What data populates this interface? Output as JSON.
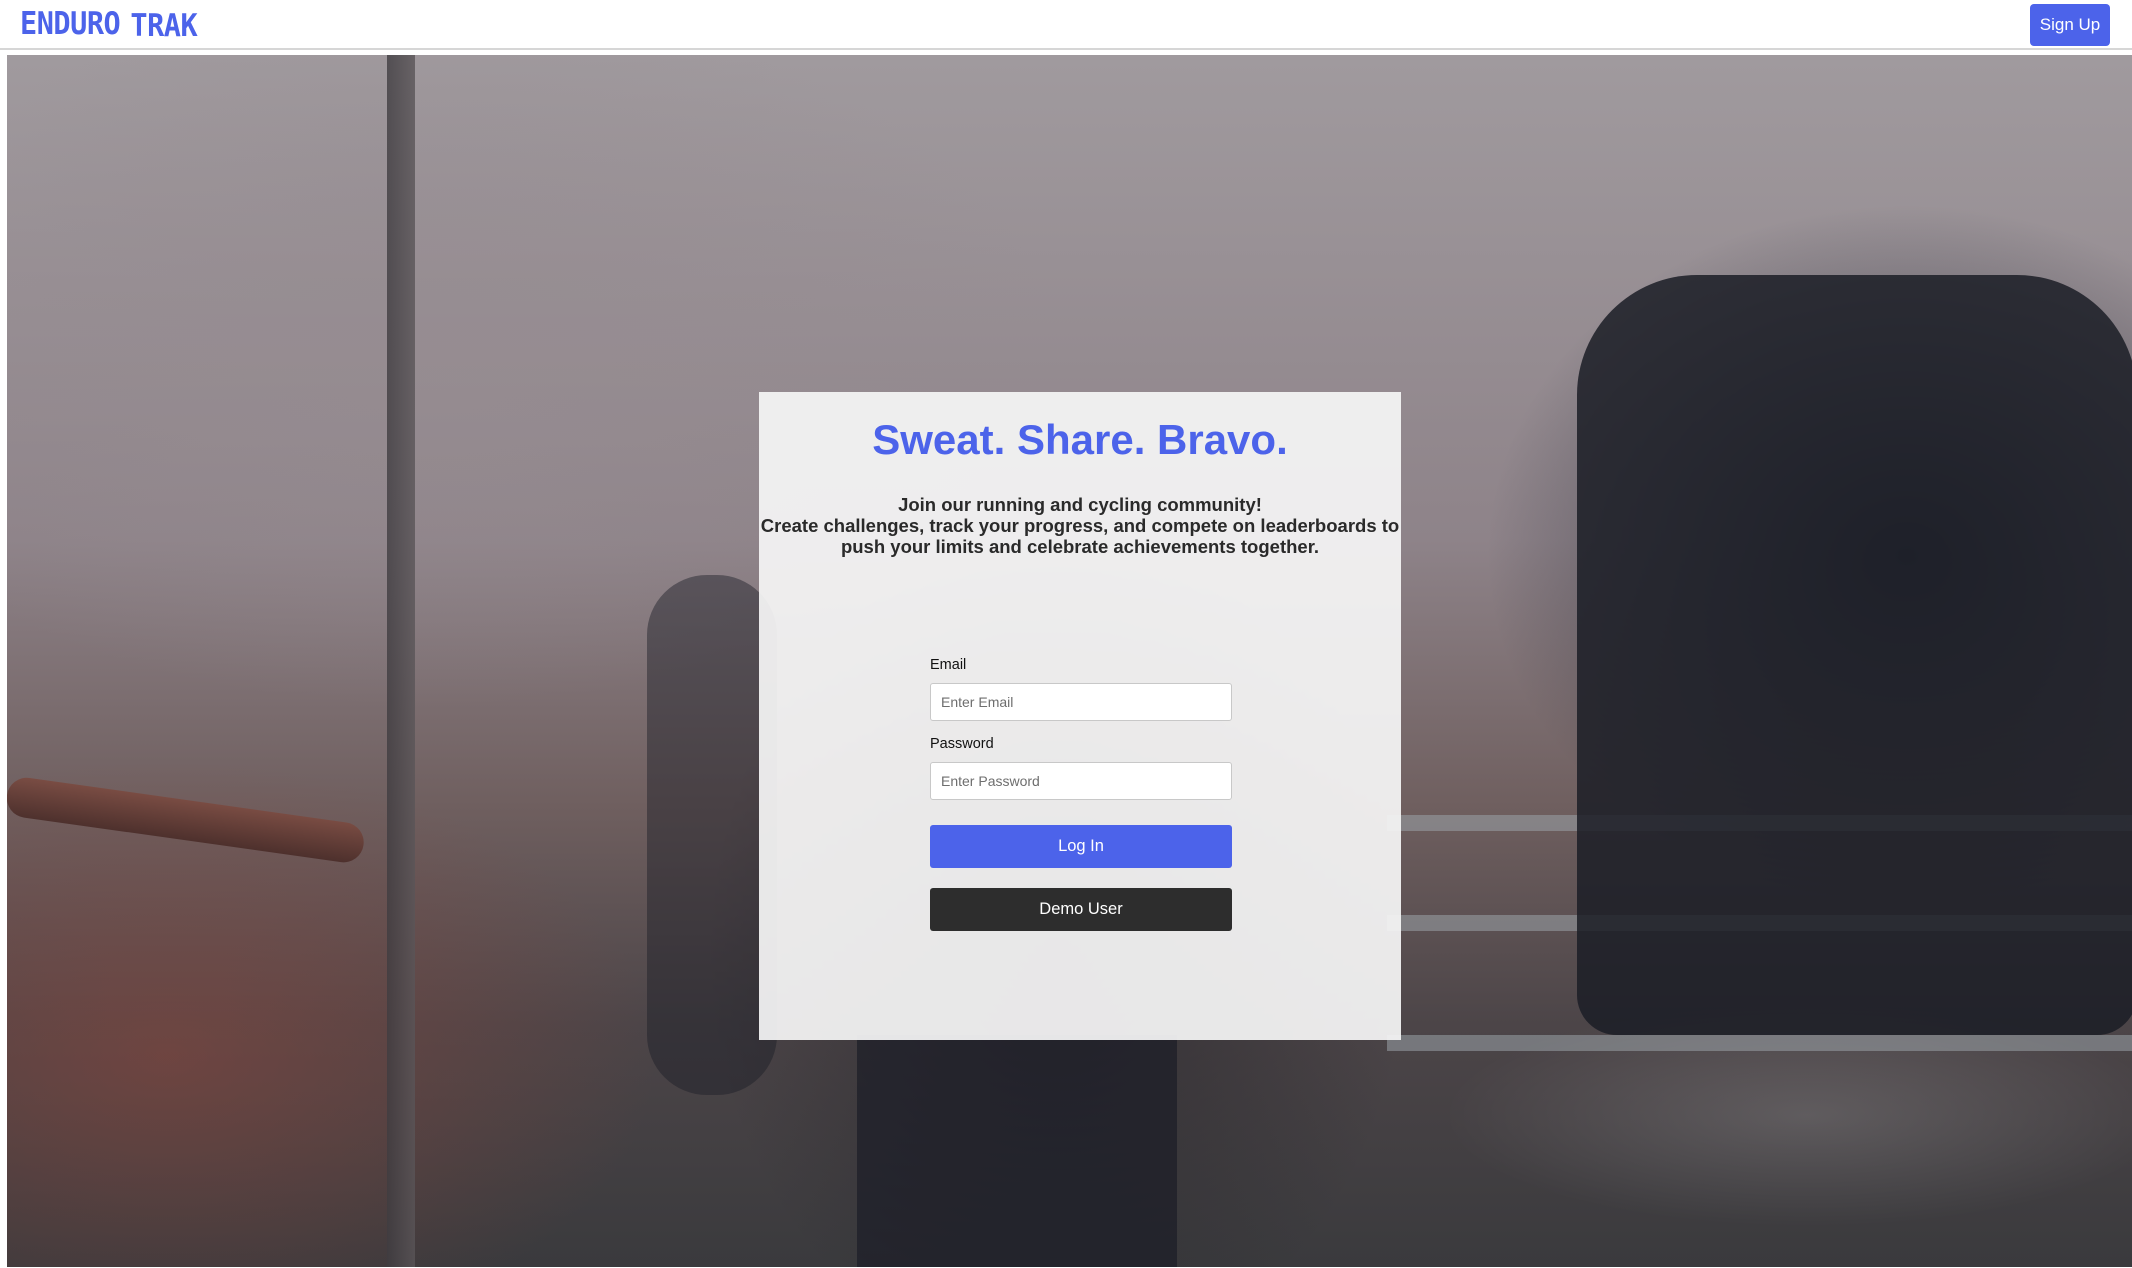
{
  "brand": {
    "logo_word1": "ENDURO",
    "logo_word2": "TRAK",
    "accent_color": "#4c63ea"
  },
  "header": {
    "signup_label": "Sign Up"
  },
  "hero": {
    "background": "runners-celebrating-photo"
  },
  "card": {
    "title": "Sweat. Share. Bravo.",
    "tagline": "Join our running and cycling community!",
    "description": "Create challenges, track your progress, and compete on leaderboards to push your limits and celebrate achievements together."
  },
  "form": {
    "email_label": "Email",
    "email_placeholder": "Enter Email",
    "email_value": "",
    "password_label": "Password",
    "password_placeholder": "Enter Password",
    "password_value": "",
    "login_label": "Log In",
    "demo_label": "Demo User",
    "demo_button_color": "#2d2d2d"
  }
}
